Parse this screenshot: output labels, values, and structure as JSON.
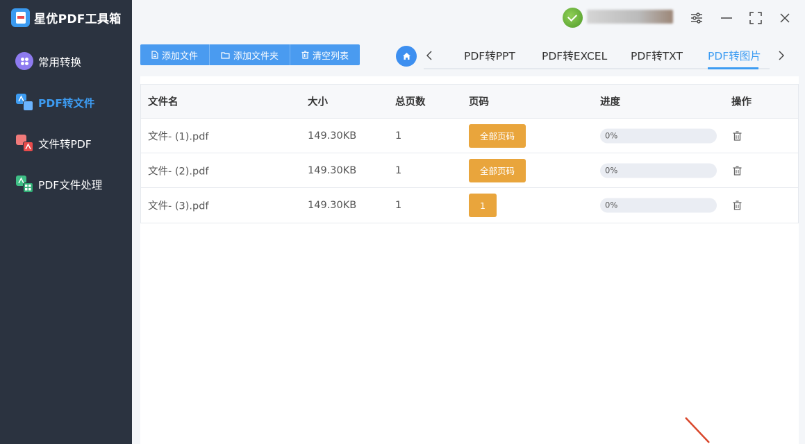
{
  "app": {
    "title": "星优PDF工具箱"
  },
  "sidebar": {
    "items": [
      {
        "label": "常用转换",
        "active": false,
        "icon": "apps-icon"
      },
      {
        "label": "PDF转文件",
        "active": true,
        "icon": "pdf-to-file-icon"
      },
      {
        "label": "文件转PDF",
        "active": false,
        "icon": "file-to-pdf-icon"
      },
      {
        "label": "PDF文件处理",
        "active": false,
        "icon": "pdf-process-icon"
      }
    ]
  },
  "window": {
    "icons": [
      "settings-sliders-icon",
      "minimize-icon",
      "maximize-icon",
      "close-icon"
    ]
  },
  "toolbar": {
    "add_file": "添加文件",
    "add_folder": "添加文件夹",
    "clear_list": "清空列表"
  },
  "tabs": {
    "items": [
      {
        "label": "PDF转PPT",
        "active": false
      },
      {
        "label": "PDF转EXCEL",
        "active": false
      },
      {
        "label": "PDF转TXT",
        "active": false
      },
      {
        "label": "PDF转图片",
        "active": true
      }
    ]
  },
  "table": {
    "headers": {
      "name": "文件名",
      "size": "大小",
      "pages": "总页数",
      "page_range": "页码",
      "progress": "进度",
      "action": "操作"
    },
    "rows": [
      {
        "name": "文件- (1).pdf",
        "size": "149.30KB",
        "pages": "1",
        "page_range": "全部页码",
        "progress": 0,
        "progress_label": "0%"
      },
      {
        "name": "文件- (2).pdf",
        "size": "149.30KB",
        "pages": "1",
        "page_range": "全部页码",
        "progress": 0,
        "progress_label": "0%"
      },
      {
        "name": "文件- (3).pdf",
        "size": "149.30KB",
        "pages": "1",
        "page_range": "1",
        "progress": 0,
        "progress_label": "0%"
      }
    ]
  },
  "colors": {
    "sidebar_bg": "#2b3340",
    "accent": "#3d9cf2",
    "page_button": "#e9a53c",
    "progress_track": "#eaedf3"
  }
}
